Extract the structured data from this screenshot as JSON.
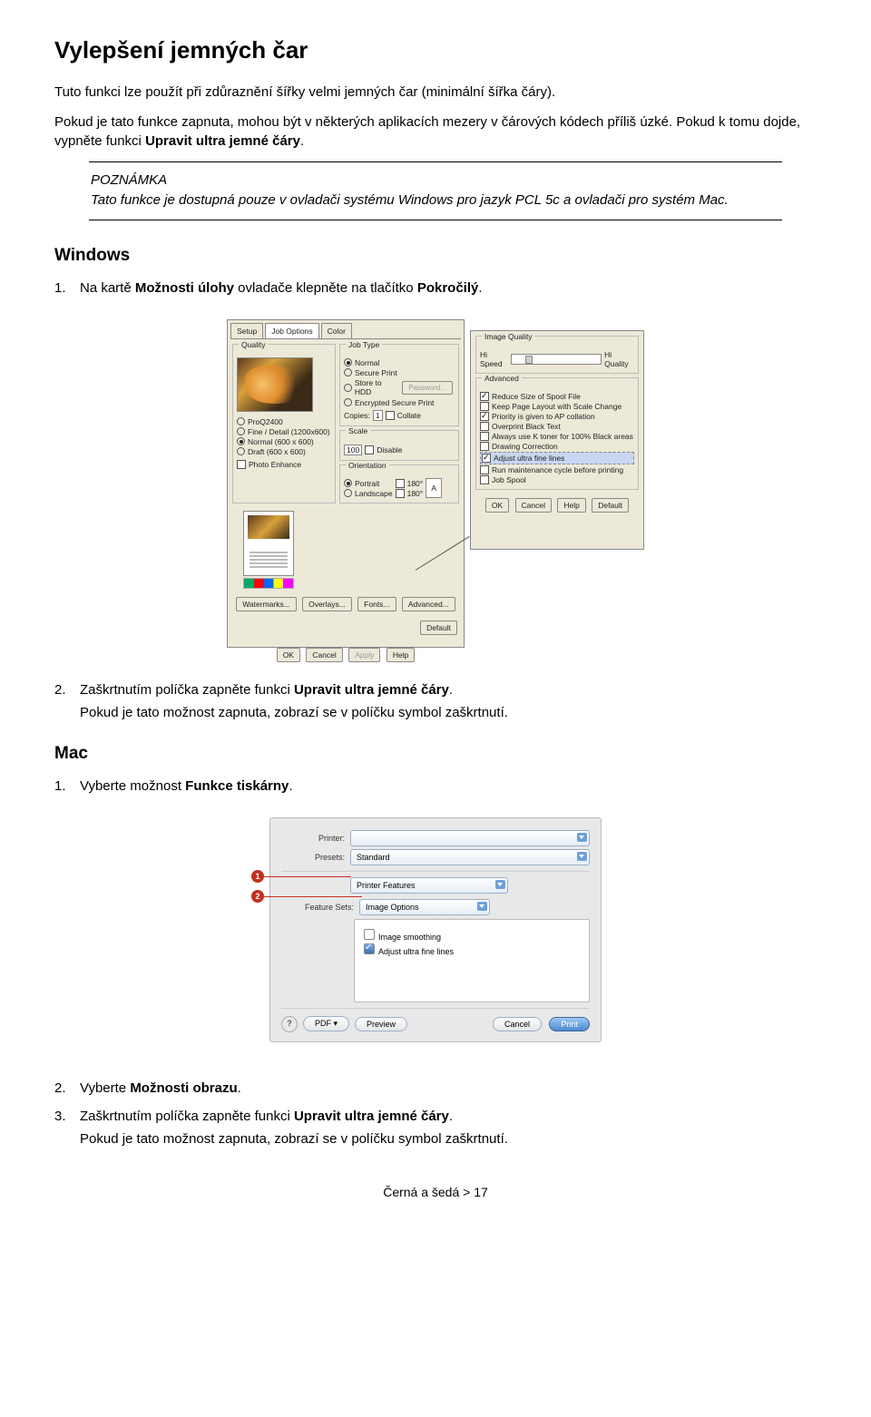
{
  "title": "Vylepšení jemných čar",
  "intro": "Tuto funkci lze použít při zdůraznění šířky velmi jemných čar (minimální šířka čáry).",
  "intro2a": "Pokud je tato funkce zapnuta, mohou být v některých aplikacích mezery v čárových kódech příliš úzké. Pokud k tomu dojde, vypněte funkci ",
  "intro2bold": "Upravit ultra jemné čáry",
  "intro2b": ".",
  "note_title": "POZNÁMKA",
  "note_body": "Tato funkce je dostupná pouze v ovladači systému Windows pro jazyk PCL 5c a ovladači pro systém Mac.",
  "windows_heading": "Windows",
  "win_step1a": "Na kartě ",
  "win_step1b": "Možnosti úlohy",
  "win_step1c": " ovladače klepněte na tlačítko ",
  "win_step1d": "Pokročilý",
  "win_step1e": ".",
  "win_step2a": "Zaškrtnutím políčka zapněte funkci ",
  "win_step2b": "Upravit ultra jemné čáry",
  "win_step2c": ".",
  "win_step2_extra": "Pokud je tato možnost zapnuta, zobrazí se v políčku symbol zaškrtnutí.",
  "mac_heading": "Mac",
  "mac_step1a": "Vyberte možnost ",
  "mac_step1b": "Funkce tiskárny",
  "mac_step1c": ".",
  "mac_step2a": "Vyberte ",
  "mac_step2b": "Možnosti obrazu",
  "mac_step2c": ".",
  "mac_step3a": "Zaškrtnutím políčka zapněte funkci ",
  "mac_step3b": "Upravit ultra jemné čáry",
  "mac_step3c": ".",
  "mac_step3_extra": "Pokud je tato možnost zapnuta, zobrazí se v políčku symbol zaškrtnutí.",
  "footer": "Černá a šedá > 17",
  "win": {
    "tabs": {
      "setup": "Setup",
      "job": "Job Options",
      "color": "Color"
    },
    "quality": {
      "title": "Quality",
      "proq": "ProQ2400",
      "fine": "Fine / Detail (1200x600)",
      "normal": "Normal (600 x 600)",
      "draft": "Draft (600 x 600)",
      "photo": "Photo Enhance"
    },
    "jobtype": {
      "title": "Job Type",
      "normal": "Normal",
      "secure": "Secure Print",
      "store": "Store to HDD",
      "encrypted": "Encrypted Secure Print",
      "password": "Password...",
      "copies": "Copies:",
      "copies_val": "1",
      "collate": "Collate"
    },
    "scale": {
      "title": "Scale",
      "val": "100",
      "disable": "Disable"
    },
    "orient": {
      "title": "Orientation",
      "portrait": "Portrait",
      "landscape": "Landscape",
      "r180a": "180°",
      "r180b": "180°",
      "a": "A"
    },
    "buttons": {
      "watermarks": "Watermarks...",
      "overlays": "Overlays...",
      "fonts": "Fonts...",
      "advanced": "Advanced...",
      "default": "Default",
      "ok": "OK",
      "cancel": "Cancel",
      "apply": "Apply",
      "help": "Help"
    },
    "adv": {
      "iq": "Image Quality",
      "hispeed": "Hi Speed",
      "hiquality": "Hi Quality",
      "advanced": "Advanced",
      "reduce": "Reduce Size of Spool File",
      "keep": "Keep Page Layout with Scale Change",
      "priority": "Priority is given to AP collation",
      "overprint": "Overprint Black Text",
      "ktoner": "Always use K toner for 100% Black areas",
      "drawing": "Drawing Correction",
      "adjust": "Adjust ultra fine lines",
      "maint": "Run maintenance cycle before printing",
      "jobspool": "Job Spool",
      "ok": "OK",
      "cancel": "Cancel",
      "help": "Help",
      "default": "Default"
    }
  },
  "mac": {
    "printer": "Printer:",
    "presets": "Presets:",
    "presets_val": "Standard",
    "section": "Printer Features",
    "feature_sets": "Feature Sets:",
    "feature_sets_val": "Image Options",
    "smoothing": "Image smoothing",
    "adjust": "Adjust ultra fine lines",
    "help": "?",
    "pdf": "PDF ▾",
    "preview": "Preview",
    "cancel": "Cancel",
    "print": "Print",
    "badge1": "1",
    "badge2": "2"
  }
}
